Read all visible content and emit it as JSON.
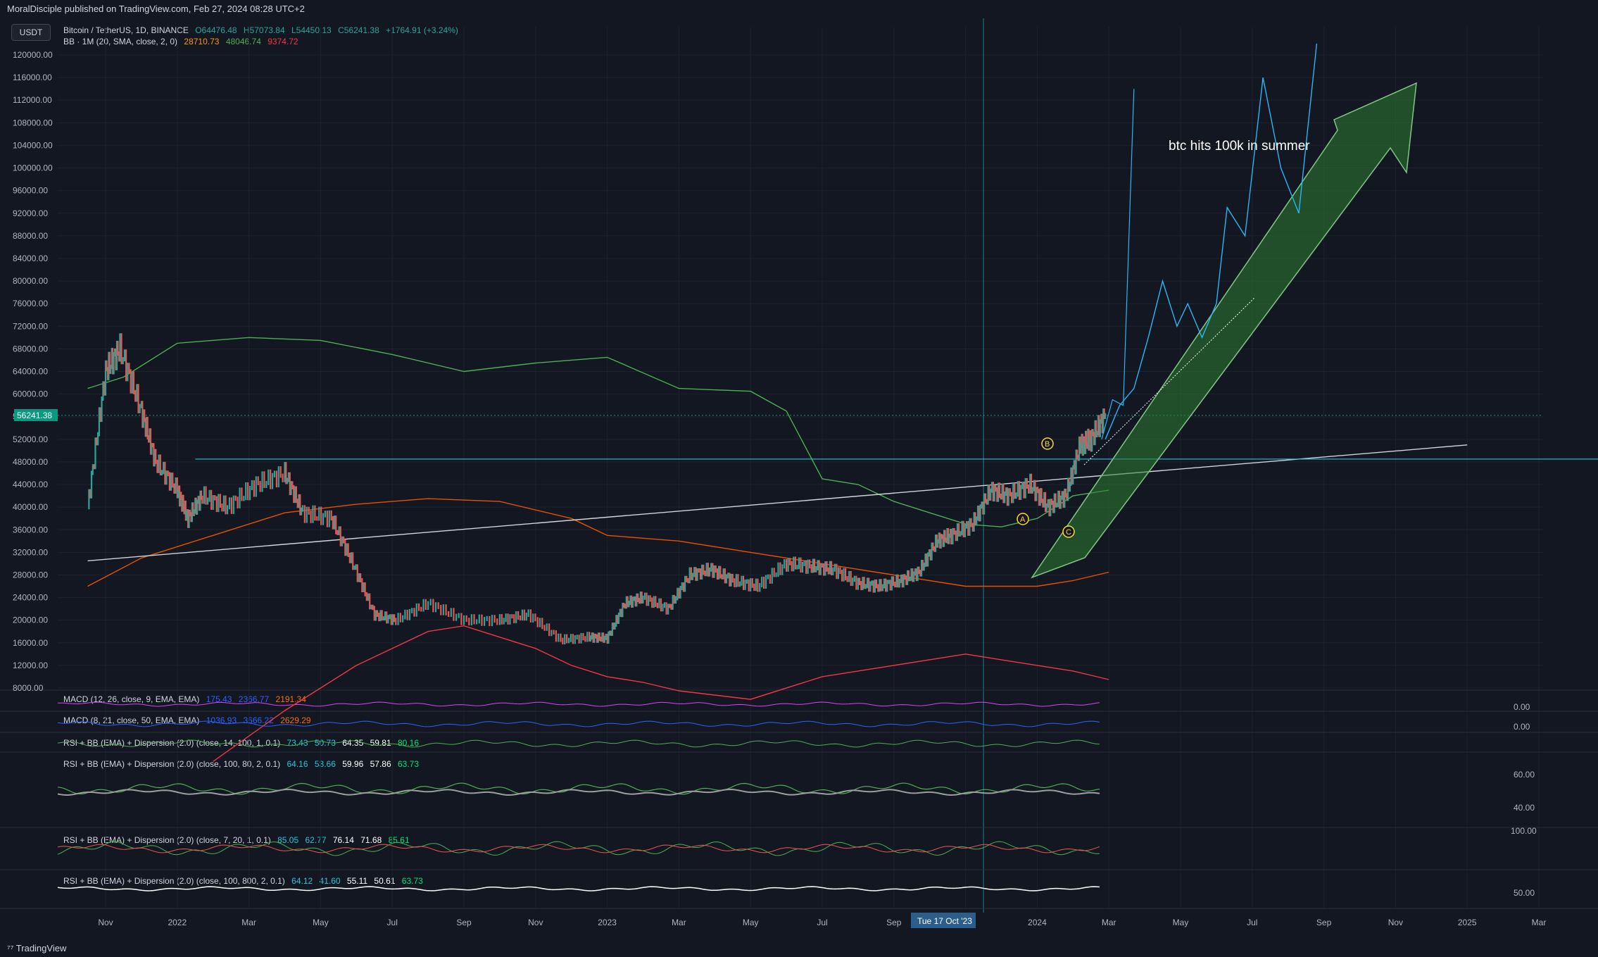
{
  "header": {
    "published": "MoralDisciple published on TradingView.com, Feb 27, 2024 08:28 UTC+2"
  },
  "toolbar": {
    "currency_label": "USDT"
  },
  "legend": {
    "symbol": "Bitcoin / TetherUS, 1D, BINANCE",
    "ohlc": {
      "o": "O64476.48",
      "h": "H57073.84",
      "l": "L54450.13",
      "c": "C56241.38",
      "chg": "+1764.91 (+3.24%)"
    },
    "bb": {
      "label": "BB · 1M (20, SMA, close, 2, 0)",
      "v1": "28710.73",
      "v2": "48046.74",
      "v3": "9374.72"
    }
  },
  "indicators": {
    "macd1": {
      "label": "MACD (12, 26, close, 9, EMA, EMA)",
      "v1": "175.43",
      "v2": "2366.77",
      "v3": "2191.34"
    },
    "macd2": {
      "label": "MACD (8, 21, close, 50, EMA, EMA)",
      "v1": "1036.93",
      "v2": "3666.22",
      "v3": "2629.29"
    },
    "rsi1": {
      "label": "RSI + BB (EMA) + Dispersion (2.0) (close, 14, 100, 1, 0.1)",
      "v1": "73.43",
      "v2": "50.73",
      "v3": "64.35",
      "v4": "59.81",
      "v5": "80.16"
    },
    "rsi2": {
      "label": "RSI + BB (EMA) + Dispersion (2.0) (close, 100, 80, 2, 0.1)",
      "v1": "64.16",
      "v2": "53.66",
      "v3": "59.96",
      "v4": "57.86",
      "v5": "63.73"
    },
    "rsi3": {
      "label": "RSI + BB (EMA) + Dispersion (2.0) (close, 7, 20, 1, 0.1)",
      "v1": "85.05",
      "v2": "62.77",
      "v3": "76.14",
      "v4": "71.68",
      "v5": "85.61"
    },
    "rsi4": {
      "label": "RSI + BB (EMA) + Dispersion (2.0) (close, 100, 800, 2, 0.1)",
      "v1": "64.12",
      "v2": "41.60",
      "v3": "55.11",
      "v4": "50.61",
      "v5": "63.73"
    }
  },
  "pane_scale_labels": {
    "macd1": "0.00",
    "macd2": "0.00",
    "rsi2_hi": "60.00",
    "rsi2_lo": "40.00",
    "rsi3": "100.00",
    "rsi4": "50.00"
  },
  "annotations": {
    "note": "btc hits 100k in summer",
    "wave_a": "A",
    "wave_b": "B",
    "wave_c": "C",
    "date_marker": "Tue 17 Oct '23"
  },
  "price_label": "56241.38",
  "colors": {
    "up": "#26a69a",
    "down": "#ef5350",
    "bb_upper": "#4caf50",
    "bb_basis": "#e65100",
    "bb_lower": "#f23645",
    "projection": "#29b6f6",
    "arrow": "#2e7d32",
    "price_tag": "#089981"
  },
  "footer": {
    "brand": "TradingView"
  },
  "chart_data": {
    "type": "line",
    "title": "Bitcoin / TetherUS, 1D, BINANCE",
    "ylim": [
      8000,
      120000
    ],
    "y_ticks": [
      "120000.00",
      "116000.00",
      "112000.00",
      "108000.00",
      "104000.00",
      "100000.00",
      "96000.00",
      "92000.00",
      "88000.00",
      "84000.00",
      "80000.00",
      "76000.00",
      "72000.00",
      "68000.00",
      "64000.00",
      "60000.00",
      "56000.00",
      "52000.00",
      "48000.00",
      "44000.00",
      "40000.00",
      "36000.00",
      "32000.00",
      "28000.00",
      "24000.00",
      "20000.00",
      "16000.00",
      "12000.00",
      "8000.00"
    ],
    "x_ticks": [
      "Nov",
      "2022",
      "Mar",
      "May",
      "Jul",
      "Sep",
      "Nov",
      "2023",
      "Mar",
      "May",
      "Jul",
      "Sep",
      "Nov",
      "2024",
      "Mar",
      "May",
      "Jul",
      "Sep",
      "Nov",
      "2025",
      "Mar"
    ],
    "x_tick_month_index": [
      0,
      2,
      4,
      6,
      8,
      10,
      12,
      14,
      16,
      18,
      20,
      22,
      24,
      26,
      28,
      30,
      32,
      34,
      36,
      38,
      40
    ],
    "series": [
      {
        "name": "BTCUSDT",
        "x": [
          -0.5,
          0,
          0.4,
          1,
          1.4,
          2,
          2.3,
          2.7,
          3.4,
          4.2,
          5,
          5.5,
          6.3,
          6.9,
          7.5,
          8.1,
          9,
          10,
          11,
          11.8,
          12.7,
          13.5,
          14,
          14.5,
          15,
          15.7,
          16.3,
          16.9,
          17.5,
          18.2,
          19,
          19.7,
          20.3,
          21,
          21.6,
          22.2,
          22.7,
          23.2,
          23.6,
          24.2,
          24.7,
          25.2,
          25.8,
          26.3,
          26.8,
          27.2,
          27.5,
          27.9
        ],
        "y": [
          40000,
          64000,
          68000,
          57000,
          48000,
          43000,
          38000,
          42000,
          40000,
          44000,
          46000,
          39000,
          38000,
          30000,
          21000,
          20000,
          23000,
          20000,
          20000,
          21000,
          16500,
          17000,
          16800,
          23000,
          24000,
          22000,
          28000,
          29000,
          27000,
          26000,
          30000,
          29500,
          29000,
          26500,
          26000,
          27000,
          28500,
          34000,
          35000,
          37000,
          43000,
          42000,
          44000,
          40000,
          42000,
          51000,
          52000,
          56241
        ]
      },
      {
        "name": "Projection",
        "x": [
          27.9,
          28.3,
          28.7,
          29.1,
          29.5,
          29.9,
          30.2,
          30.6,
          31,
          31.3,
          31.8,
          32.3,
          32.8,
          33.3,
          33.8
        ],
        "y": [
          52000,
          58000,
          61000,
          70000,
          80000,
          72000,
          76000,
          70000,
          76000,
          93000,
          88000,
          116000,
          100000,
          92000,
          122000
        ]
      }
    ],
    "projection_2": {
      "x": [
        27.8,
        28.1,
        28.4,
        28.7
      ],
      "y": [
        52000,
        59000,
        58000,
        114000
      ]
    },
    "bb_upper": {
      "x": [
        -0.5,
        0.5,
        2,
        4,
        6,
        8,
        10,
        12,
        14,
        16,
        18,
        19,
        20,
        21,
        22,
        23,
        24,
        25,
        26,
        27,
        28
      ],
      "y": [
        61000,
        63000,
        69000,
        70000,
        69500,
        67000,
        64000,
        65500,
        66500,
        61000,
        60500,
        57000,
        45000,
        44000,
        41000,
        39000,
        37000,
        36500,
        38000,
        42000,
        43000
      ]
    },
    "bb_basis": {
      "x": [
        -0.5,
        1,
        3,
        5,
        7,
        9,
        11,
        13,
        14,
        15,
        16,
        18,
        20,
        22,
        24,
        26,
        27,
        28
      ],
      "y": [
        26000,
        31000,
        35000,
        39000,
        40500,
        41500,
        41000,
        38000,
        35000,
        34500,
        34000,
        32000,
        30000,
        28000,
        26000,
        26000,
        27000,
        28500
      ]
    },
    "bb_lower": {
      "x": [
        3,
        5,
        7,
        9,
        10,
        11,
        12,
        13,
        14,
        15,
        16,
        18,
        20,
        22,
        24,
        25,
        26,
        27,
        28
      ],
      "y": [
        -5000,
        4000,
        12000,
        18000,
        19000,
        17000,
        15000,
        12000,
        10000,
        9000,
        7500,
        6000,
        10000,
        12000,
        14000,
        13000,
        12000,
        11000,
        9500
      ]
    },
    "trendline": {
      "x1": -0.5,
      "y1": 30500,
      "x2": 38,
      "y2": 51000
    },
    "resistance": {
      "y": 48500,
      "x1": 2.5,
      "x2": 45
    },
    "current_price": 56241.38
  }
}
